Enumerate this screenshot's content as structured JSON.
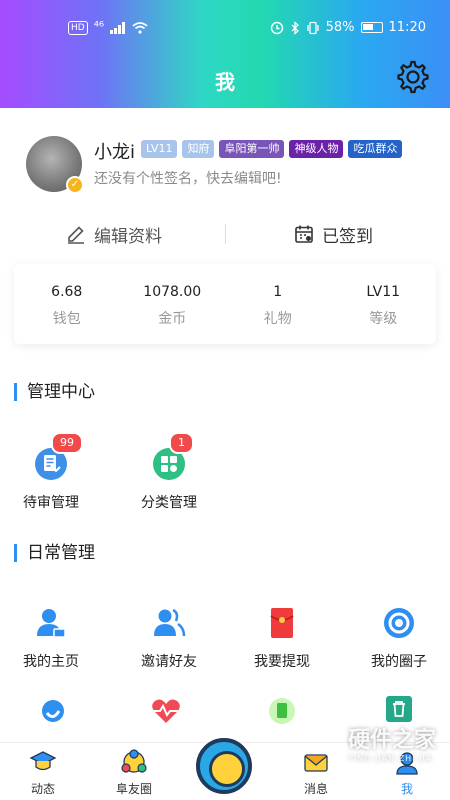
{
  "status_bar": {
    "hd": "HD",
    "network": "⁴⁶",
    "battery_percent": "58%",
    "time": "11:20"
  },
  "header": {
    "title": "我"
  },
  "profile": {
    "nickname": "小龙i",
    "tags": [
      {
        "text": "LV11",
        "color": "#a9c4ea"
      },
      {
        "text": "知府",
        "color": "#a9c4ea"
      },
      {
        "text": "阜阳第一帅",
        "color": "#7a55b8"
      },
      {
        "text": "神级人物",
        "color": "#6b21a8"
      },
      {
        "text": "吃瓜群众",
        "color": "#2563c9"
      }
    ],
    "signature": "还没有个性签名，快去编辑吧!"
  },
  "actions": {
    "edit_label": "编辑资料",
    "signin_label": "已签到"
  },
  "stats": [
    {
      "value": "6.68",
      "label": "钱包"
    },
    {
      "value": "1078.00",
      "label": "金币"
    },
    {
      "value": "1",
      "label": "礼物"
    },
    {
      "value": "LV11",
      "label": "等级"
    }
  ],
  "manage_center": {
    "title": "管理中心",
    "items": [
      {
        "label": "待审管理",
        "badge": "99",
        "icon": "review-icon"
      },
      {
        "label": "分类管理",
        "badge": "1",
        "icon": "category-icon"
      }
    ]
  },
  "daily": {
    "title": "日常管理",
    "items": [
      {
        "label": "我的主页",
        "icon": "user-home-icon"
      },
      {
        "label": "邀请好友",
        "icon": "invite-friends-icon"
      },
      {
        "label": "我要提现",
        "icon": "withdraw-icon"
      },
      {
        "label": "我的圈子",
        "icon": "circle-icon"
      }
    ]
  },
  "bottom_nav": [
    {
      "label": "动态",
      "icon": "graduation-cap-icon"
    },
    {
      "label": "阜友圈",
      "icon": "people-group-icon"
    },
    {
      "label": "消息",
      "icon": "mail-icon"
    },
    {
      "label": "我",
      "icon": "me-icon",
      "active": true
    }
  ],
  "watermark": {
    "text": "硬件之家",
    "sub": "YING JIAN ZHI JIA"
  }
}
